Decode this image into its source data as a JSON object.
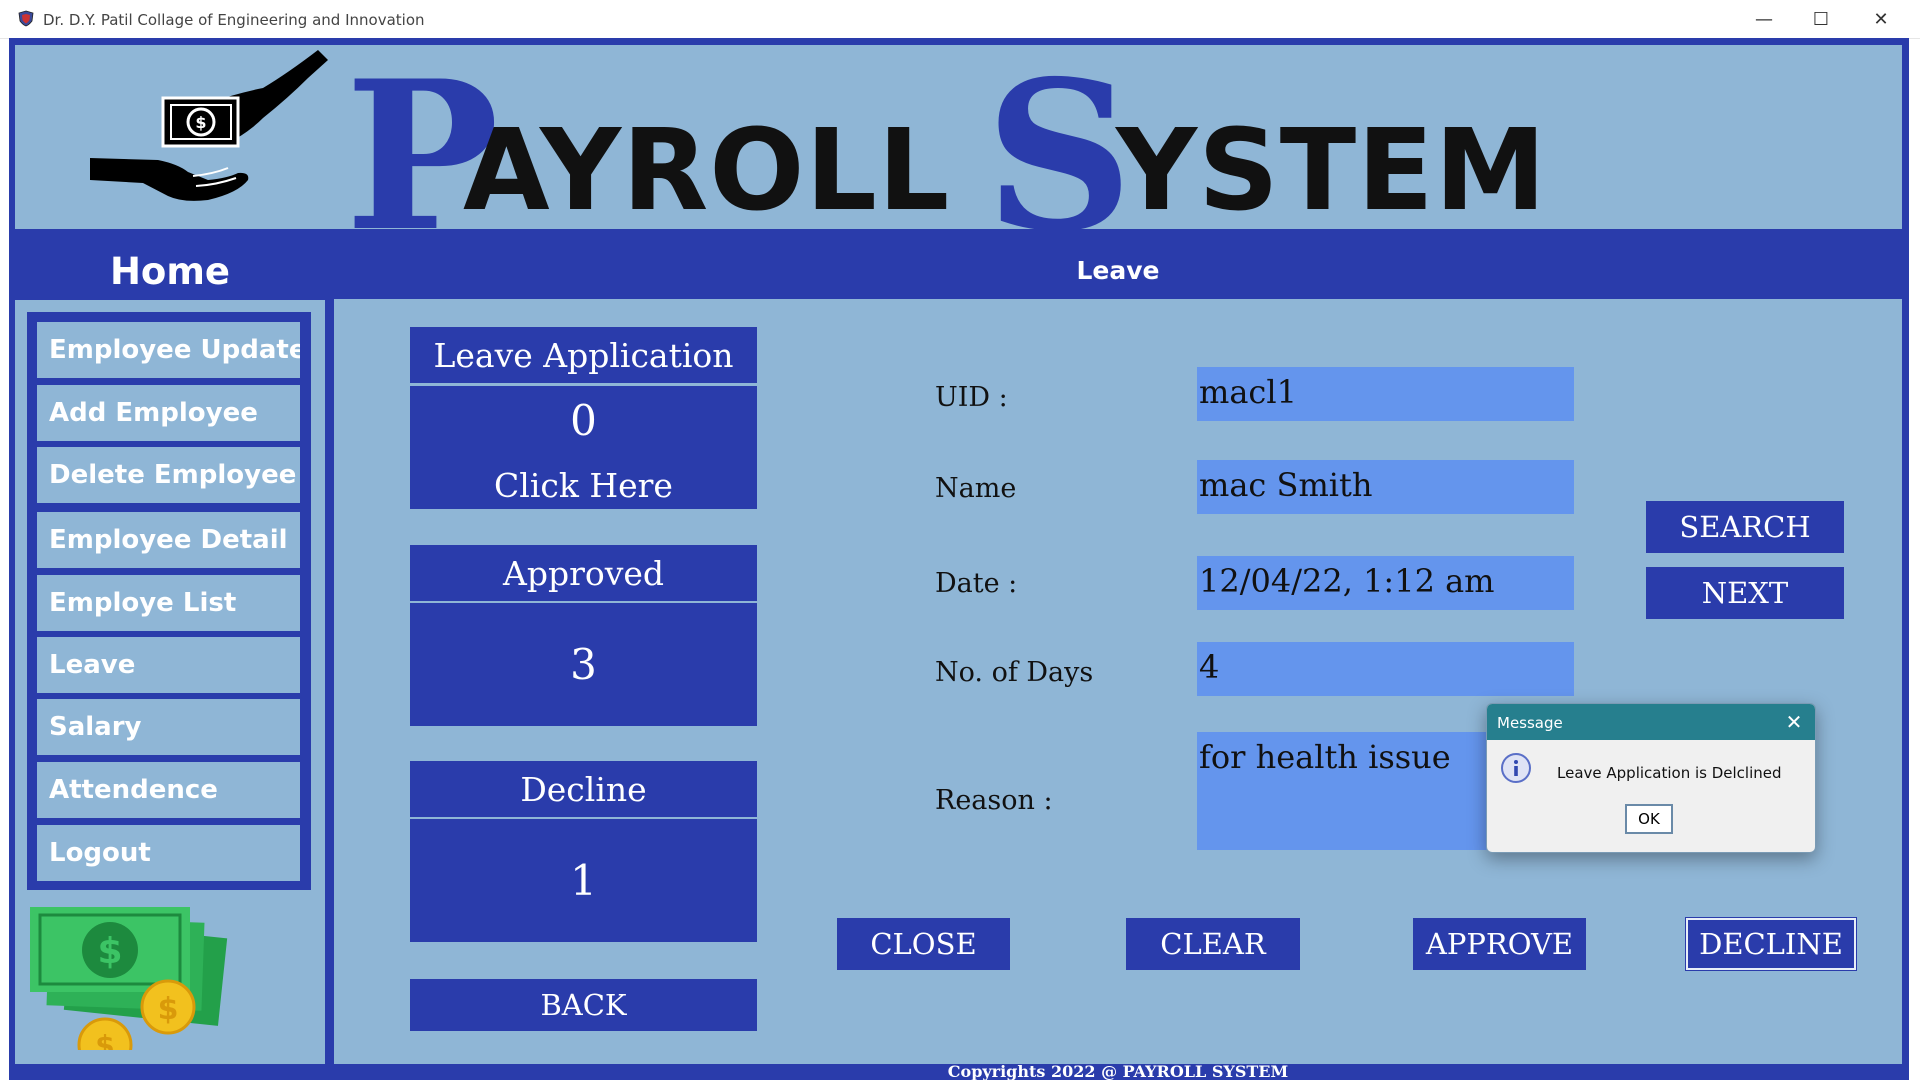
{
  "window": {
    "title": "Dr. D.Y. Patil Collage of Engineering and Innovation",
    "minimize": "—",
    "maximize": "☐",
    "close": "✕"
  },
  "banner": {
    "word1_initial": "P",
    "word1_rest": "AYROLL",
    "word2_initial": "S",
    "word2_rest": "YSTEM",
    "logo_icon": "hands-with-money-icon"
  },
  "sidebar": {
    "title": "Home",
    "items": [
      {
        "label": "Employee Update"
      },
      {
        "label": "Add Employee"
      },
      {
        "label": "Delete Employee"
      },
      {
        "label": "Employee Detail"
      },
      {
        "label": "Employe List"
      },
      {
        "label": "Leave"
      },
      {
        "label": "Salary"
      },
      {
        "label": "Attendence"
      },
      {
        "label": "Logout"
      }
    ],
    "decoration_icon": "money-stack-icon"
  },
  "main": {
    "header": "Leave",
    "cards": {
      "leave_application": {
        "title": "Leave Application",
        "count": "0",
        "action": "Click Here"
      },
      "approved": {
        "title": "Approved",
        "count": "3"
      },
      "decline": {
        "title": "Decline",
        "count": "1"
      }
    },
    "back_button": "BACK",
    "form": {
      "uid_label": "UID :",
      "uid_value": "macl1",
      "name_label": "Name",
      "name_value": "mac Smith",
      "date_label": "Date :",
      "date_value": "12/04/22, 1:12 am",
      "days_label": "No. of Days",
      "days_value": "4",
      "reason_label": "Reason :",
      "reason_value": "for health issue"
    },
    "buttons": {
      "search": "SEARCH",
      "next": "NEXT",
      "close": "CLOSE",
      "clear": "CLEAR",
      "approve": "APPROVE",
      "decline": "DECLINE"
    },
    "footer": "Copyrights 2022 @ PAYROLL SYSTEM"
  },
  "dialog": {
    "title": "Message",
    "message": "Leave Application is Delclined",
    "ok": "OK",
    "icon": "info-icon"
  },
  "colors": {
    "primary_blue": "#2a3cab",
    "light_blue": "#8fb6d6",
    "field_blue": "#6495ed",
    "dialog_title": "#267f8e"
  }
}
